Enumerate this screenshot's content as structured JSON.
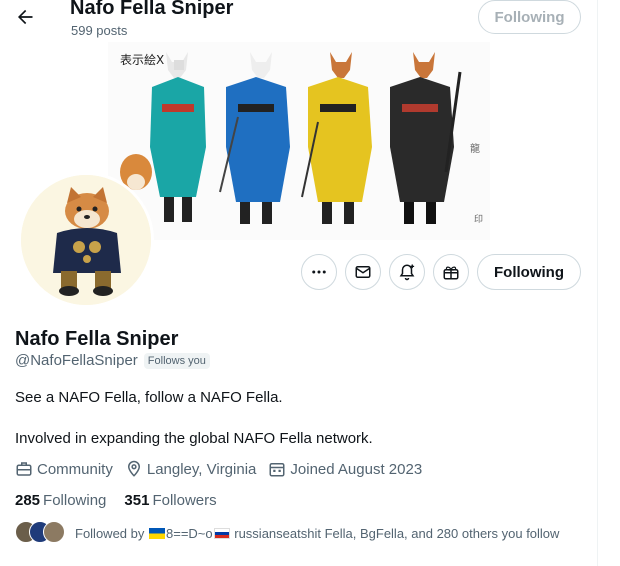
{
  "header": {
    "display_name": "Nafo Fella Sniper",
    "posts_count": "599 posts",
    "follow_button": "Following"
  },
  "actions": {
    "following_label": "Following",
    "icons": [
      "more-icon",
      "message-icon",
      "notification-bell-icon",
      "gift-icon"
    ]
  },
  "banner": {
    "watermark": "表示絵X"
  },
  "profile": {
    "name": "Nafo Fella Sniper",
    "handle": "@NafoFellaSniper",
    "follows_you": "Follows you",
    "bio_line1": "See a NAFO Fella, follow a NAFO Fella.",
    "bio_line2": "Involved in expanding the global NAFO Fella network.",
    "category": "Community",
    "location": "Langley, Virginia",
    "joined": "Joined August 2023",
    "following_count": "285",
    "following_label": "Following",
    "followers_count": "351",
    "followers_label": "Followers",
    "followed_by_prefix": "Followed by",
    "followed_by_name_mid": "8==D~o",
    "followed_by_rest": "russianseatshit Fella, BgFella, and 280 others you follow"
  },
  "colors": {
    "text_primary": "#0f1419",
    "text_secondary": "#536471",
    "border": "#cfd9de"
  }
}
